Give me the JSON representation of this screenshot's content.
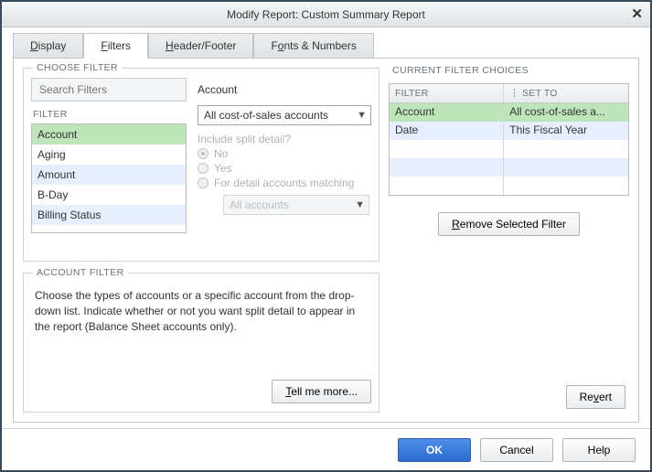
{
  "title": "Modify Report: Custom Summary Report",
  "tabs": [
    {
      "label": "Display",
      "hotkey": "D"
    },
    {
      "label": "Filters",
      "hotkey": "F"
    },
    {
      "label": "Header/Footer",
      "hotkey": "H"
    },
    {
      "label": "Fonts & Numbers",
      "hotkey": "o"
    }
  ],
  "active_tab": 1,
  "choose_filter": {
    "legend": "CHOOSE FILTER",
    "search_placeholder": "Search Filters",
    "filter_label": "FILTER",
    "items": [
      "Account",
      "Aging",
      "Amount",
      "B-Day",
      "Billing Status"
    ],
    "selected_index": 0,
    "current_filter_name": "Account",
    "dropdown_value": "All cost-of-sales accounts",
    "split_label": "Include split detail?",
    "radios": [
      "No",
      "Yes",
      "For detail accounts matching"
    ],
    "radio_selected": 0,
    "split_accounts_value": "All accounts"
  },
  "account_filter_box": {
    "legend": "ACCOUNT FILTER",
    "text": "Choose the types of accounts or a specific account from the drop-down list. Indicate whether or not you want split detail to appear in the report (Balance Sheet accounts only).",
    "tell_me_more": "Tell me more..."
  },
  "current_choices": {
    "legend": "CURRENT FILTER CHOICES",
    "col_filter": "FILTER",
    "col_set_to": "SET TO",
    "rows": [
      {
        "filter": "Account",
        "set_to": "All cost-of-sales a..."
      },
      {
        "filter": "Date",
        "set_to": "This Fiscal Year"
      }
    ],
    "remove_label": "Remove Selected Filter"
  },
  "revert_label": "Revert",
  "buttons": {
    "ok": "OK",
    "cancel": "Cancel",
    "help": "Help"
  }
}
